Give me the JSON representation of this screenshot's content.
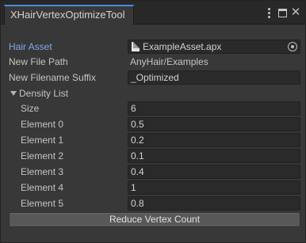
{
  "window": {
    "tab_title": "XHairVertexOptimizeTool"
  },
  "inspector": {
    "hair_asset": {
      "label": "Hair Asset",
      "value": "ExampleAsset.apx"
    },
    "new_file_path": {
      "label": "New File Path",
      "value": "AnyHair/Examples"
    },
    "new_filename_suffix": {
      "label": "New Filename Suffix",
      "value": "_Optimized"
    },
    "density_list": {
      "label": "Density List",
      "expanded": true,
      "size_label": "Size",
      "size": "6",
      "elements": [
        {
          "label": "Element 0",
          "value": "0.5"
        },
        {
          "label": "Element 1",
          "value": "0.2"
        },
        {
          "label": "Element 2",
          "value": "0.1"
        },
        {
          "label": "Element 3",
          "value": "0.4"
        },
        {
          "label": "Element 4",
          "value": "1"
        },
        {
          "label": "Element 5",
          "value": "0.8"
        }
      ]
    },
    "reduce_button_label": "Reduce Vertex Count"
  },
  "colors": {
    "accent_label": "#7cabea",
    "tab_highlight": "#4a8ee2",
    "panel_bg": "#383838"
  }
}
